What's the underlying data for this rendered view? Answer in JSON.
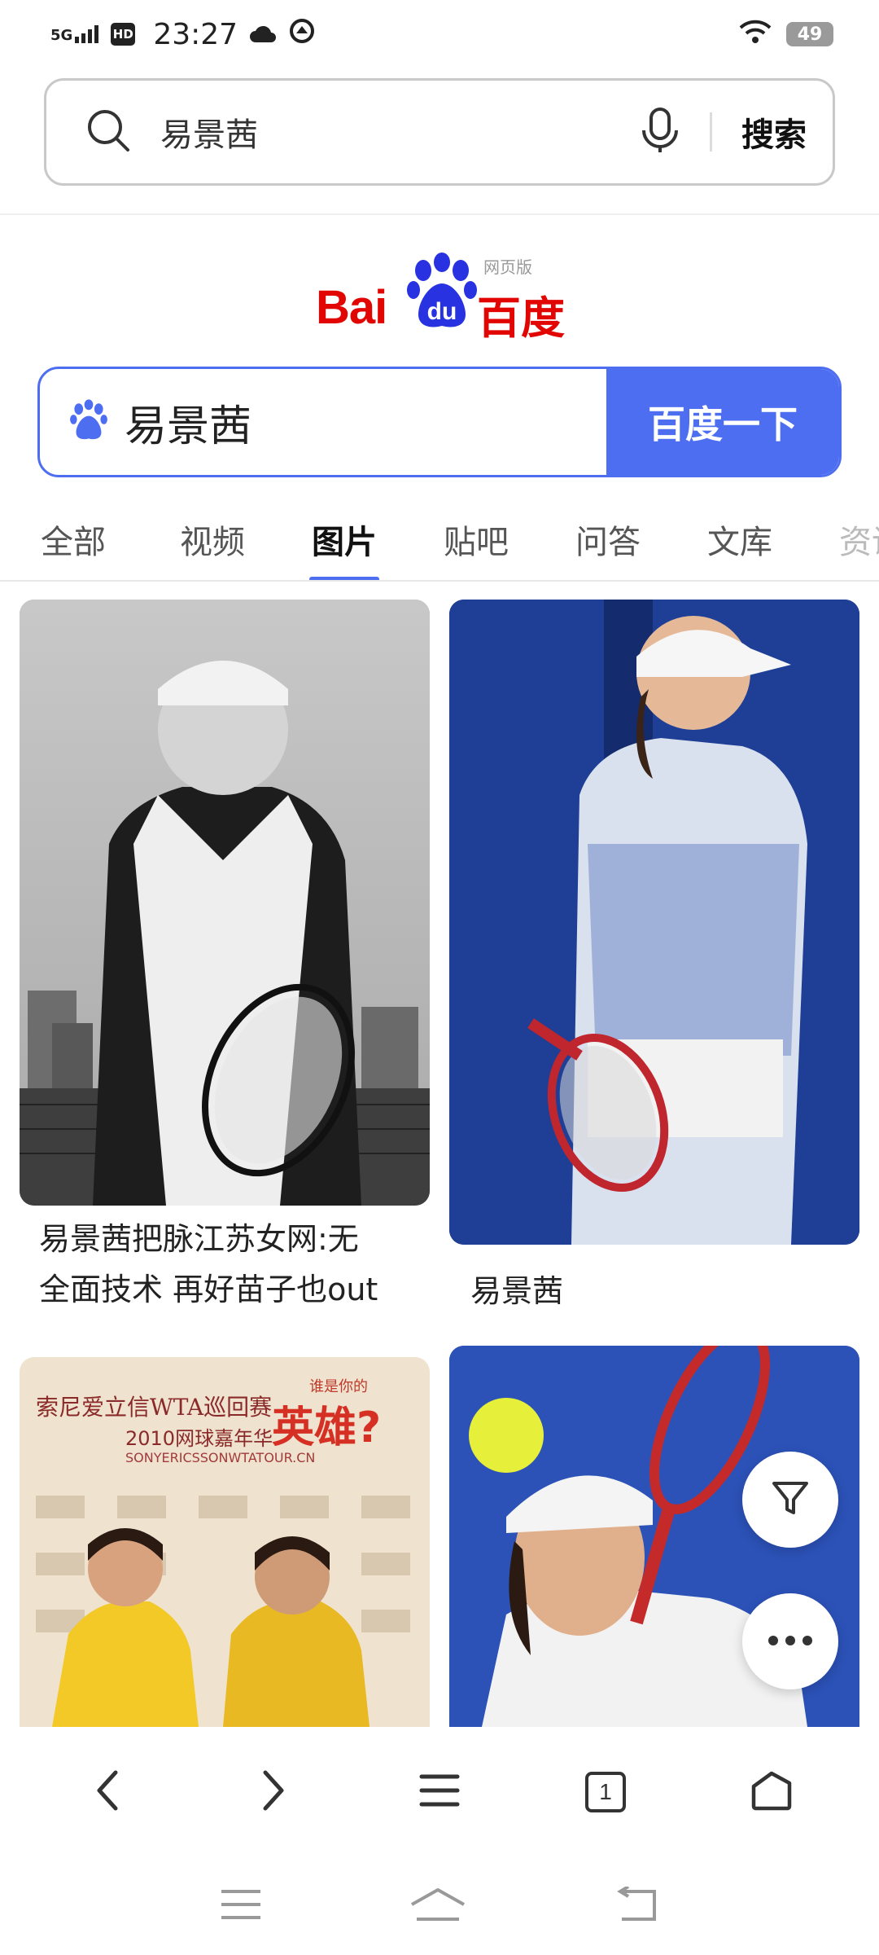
{
  "status_bar": {
    "network": "5G",
    "hd": "HD",
    "time": "23:27",
    "battery": "49"
  },
  "browser": {
    "query": "易景茜",
    "search_label": "搜索"
  },
  "baidu": {
    "logo_latin": "Bai",
    "logo_du": "du",
    "logo_cn": "百度",
    "web_version": "网页版",
    "query": "易景茜",
    "search_button": "百度一下"
  },
  "tabs": [
    {
      "label": "全部"
    },
    {
      "label": "视频"
    },
    {
      "label": "图片",
      "active": true
    },
    {
      "label": "贴吧"
    },
    {
      "label": "问答"
    },
    {
      "label": "文库"
    },
    {
      "label": "资讯"
    }
  ],
  "results": [
    {
      "caption_line1": "易景茜把脉江苏女网:无",
      "caption_line2": "全面技术 再好苗子也out"
    },
    {
      "caption_line1": "易景茜"
    }
  ],
  "poster": {
    "line1": "索尼爱立信WTA巡回赛",
    "line2": "2010网球嘉年华",
    "line3": "SONYERICSSONWTATOUR.CN",
    "question": "谁是你的",
    "hero": "英雄?"
  },
  "colors": {
    "baidu_blue": "#4e6ef2",
    "baidu_red": "#e10602"
  },
  "icons": {
    "filter": "filter-icon",
    "more": "more-icon",
    "back": "chevron-left-icon",
    "forward": "chevron-right-icon",
    "menu": "menu-icon",
    "tabs": "tabs-icon",
    "home": "home-icon"
  },
  "toolbar": {
    "tab_count": "1"
  }
}
